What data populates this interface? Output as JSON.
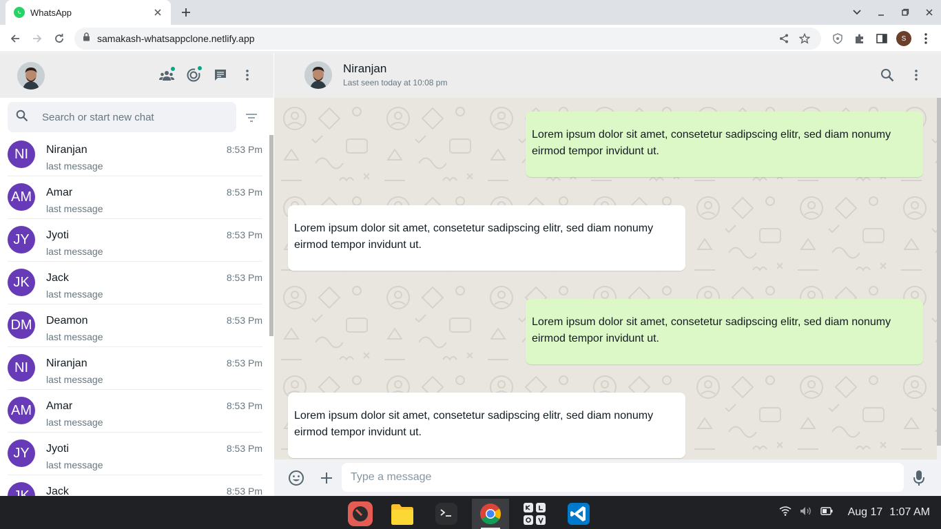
{
  "browser": {
    "tab_title": "WhatsApp",
    "url": "samakash-whatsappclone.netlify.app",
    "profile_initial": "S"
  },
  "sidebar": {
    "search_placeholder": "Search or start new chat",
    "chats": [
      {
        "initials": "NI",
        "name": "Niranjan",
        "last": "last message",
        "time": "8:53 Pm"
      },
      {
        "initials": "AM",
        "name": "Amar",
        "last": "last message",
        "time": "8:53 Pm"
      },
      {
        "initials": "JY",
        "name": "Jyoti",
        "last": "last message",
        "time": "8:53 Pm"
      },
      {
        "initials": "JK",
        "name": "Jack",
        "last": "last message",
        "time": "8:53 Pm"
      },
      {
        "initials": "DM",
        "name": "Deamon",
        "last": "last message",
        "time": "8:53 Pm"
      },
      {
        "initials": "NI",
        "name": "Niranjan",
        "last": "last message",
        "time": "8:53 Pm"
      },
      {
        "initials": "AM",
        "name": "Amar",
        "last": "last message",
        "time": "8:53 Pm"
      },
      {
        "initials": "JY",
        "name": "Jyoti",
        "last": "last message",
        "time": "8:53 Pm"
      },
      {
        "initials": "JK",
        "name": "Jack",
        "last": "",
        "time": "8:53 Pm"
      }
    ]
  },
  "conversation": {
    "name": "Niranjan",
    "status": "Last seen today at 10:08 pm",
    "messages": [
      {
        "direction": "out",
        "text": "Lorem ipsum dolor sit amet, consetetur sadipscing elitr, sed diam nonumy eirmod tempor invidunt ut."
      },
      {
        "direction": "in",
        "text": "Lorem ipsum dolor sit amet, consetetur sadipscing elitr, sed diam nonumy eirmod tempor invidunt ut."
      },
      {
        "direction": "out",
        "text": "Lorem ipsum dolor sit amet, consetetur sadipscing elitr, sed diam nonumy eirmod tempor invidunt ut."
      },
      {
        "direction": "in",
        "text": "Lorem ipsum dolor sit amet, consetetur sadipscing elitr, sed diam nonumy eirmod tempor invidunt ut."
      }
    ],
    "composer_placeholder": "Type a message"
  },
  "shelf": {
    "apps": [
      "sketch-app-icon",
      "files-app-icon",
      "terminal-app-icon",
      "chrome-app-icon",
      "keyboard-app-icon",
      "vscode-app-icon"
    ],
    "date": "Aug 17",
    "time": "1:07 AM"
  },
  "colors": {
    "avatar_purple": "#673ab7",
    "outgoing_bubble": "#dcf8c6",
    "header_gray": "#ededed",
    "wallpaper": "#e9e5df"
  }
}
